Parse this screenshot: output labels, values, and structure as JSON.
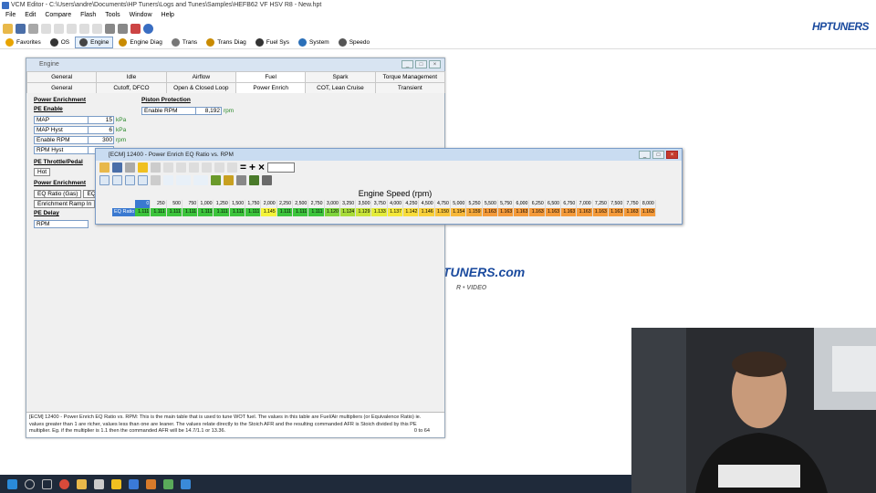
{
  "app": {
    "title": "VCM Editor - C:\\Users\\andre\\Documents\\HP Tuners\\Logs and Tunes\\Samples\\HEFB62 VF HSV R8 - New.hpt",
    "menu": [
      "File",
      "Edit",
      "Compare",
      "Flash",
      "Tools",
      "Window",
      "Help"
    ],
    "logo": "HPTUNERS"
  },
  "nav": [
    {
      "label": "Favorites",
      "icon": "star-icon",
      "color": "#e8a400"
    },
    {
      "label": "OS",
      "icon": "chip-icon",
      "color": "#333333"
    },
    {
      "label": "Engine",
      "icon": "engine-icon",
      "color": "#444444"
    },
    {
      "label": "Engine Diag",
      "icon": "engine-diag-icon",
      "color": "#c98b00"
    },
    {
      "label": "Trans",
      "icon": "gear-icon",
      "color": "#777777"
    },
    {
      "label": "Trans Diag",
      "icon": "trans-diag-icon",
      "color": "#c98b00"
    },
    {
      "label": "Fuel Sys",
      "icon": "fuel-pump-icon",
      "color": "#333333"
    },
    {
      "label": "System",
      "icon": "globe-icon",
      "color": "#2a6fb8"
    },
    {
      "label": "Speedo",
      "icon": "speedometer-icon",
      "color": "#555555"
    }
  ],
  "engine_window": {
    "title": "Engine",
    "tabs_row1": [
      "General",
      "Idle",
      "Airflow",
      "Fuel",
      "Spark",
      "Torque Management"
    ],
    "tabs_row2": [
      "General",
      "Cutoff, DFCO",
      "Open & Closed Loop",
      "Power Enrich",
      "COT, Lean Cruise",
      "Transient"
    ],
    "power_enrichment_title": "Power Enrichment",
    "pe_enable_title": "PE Enable",
    "pe_enable_fields": [
      {
        "label": "MAP",
        "value": "15",
        "unit": "kPa"
      },
      {
        "label": "MAP Hyst",
        "value": "6",
        "unit": "kPa"
      },
      {
        "label": "Enable RPM",
        "value": "300",
        "unit": "rpm"
      },
      {
        "label": "RPM Hyst",
        "value": "",
        "unit": ""
      }
    ],
    "pe_throttle_title": "PE Throttle/Pedal",
    "pe_throttle_button": "Hot",
    "power_enrichment2_title": "Power Enrichment",
    "eq_ratio_button": "EQ Ratio (Gas)",
    "eq_ratio_button2": "EQ R",
    "enrichment_ramp_button": "Enrichment Ramp In",
    "pe_delay_title": "PE Delay",
    "pe_delay_field": "RPM",
    "piston_title": "Piston Protection",
    "piston_field": {
      "label": "Enable RPM",
      "value": "8,192",
      "unit": "rpm"
    },
    "status_text": "[ECM] 12400 - Power Enrich EQ Ratio vs. RPM: This is the main table that is used to tune WOT fuel. The values in this table are Fuel/Air multipliers (or Equivalence Ratio) ie. values greater than 1 are richer, values less than one are leaner. The values relate directly to the Stoich AFR and the resulting commanded AFR is Stoich divided by this PE multiplier. Eg. if the multiplier is 1.1 then the commanded AFR will be 14.7/1.1 or 13.36.",
    "status_range": "0 to 64"
  },
  "table_window": {
    "title": "[ECM] 12400 - Power Enrich EQ Ratio vs. RPM",
    "header": "Engine Speed (rpm)",
    "row_label": "EQ Ratio",
    "rpm": [
      "0",
      "250",
      "500",
      "750",
      "1,000",
      "1,250",
      "1,500",
      "1,750",
      "2,000",
      "2,250",
      "2,500",
      "2,750",
      "3,000",
      "3,250",
      "3,500",
      "3,750",
      "4,000",
      "4,250",
      "4,500",
      "4,750",
      "5,000",
      "5,250",
      "5,500",
      "5,750",
      "6,000",
      "6,250",
      "6,500",
      "6,750",
      "7,000",
      "7,250",
      "7,500",
      "7,750",
      "8,000"
    ],
    "values": [
      "1.111",
      "1.111",
      "1.111",
      "1.111",
      "1.111",
      "1.111",
      "1.111",
      "1.111",
      "1.145",
      "1.111",
      "1.111",
      "1.111",
      "1.120",
      "1.124",
      "1.129",
      "1.133",
      "1.137",
      "1.142",
      "1.146",
      "1.150",
      "1.154",
      "1.159",
      "1.163",
      "1.163",
      "1.163",
      "1.163",
      "1.163",
      "1.163",
      "1.163",
      "1.163",
      "1.163",
      "1.163",
      "1.163"
    ],
    "colors": [
      "#3cc43c",
      "#3cc43c",
      "#3cc43c",
      "#3cc43c",
      "#3cc43c",
      "#3cc43c",
      "#3cc43c",
      "#3cc43c",
      "#f4f43a",
      "#3cc43c",
      "#3cc43c",
      "#3cc43c",
      "#7fd43c",
      "#a8dc3a",
      "#c8e43a",
      "#e4ec3a",
      "#f4e83a",
      "#f8dc3a",
      "#f8d03a",
      "#f8c43a",
      "#f8b83a",
      "#f4a83a",
      "#f49a3a",
      "#f49a3a",
      "#f49a3a",
      "#f49a3a",
      "#f49a3a",
      "#f49a3a",
      "#f49a3a",
      "#f49a3a",
      "#f49a3a",
      "#f49a3a",
      "#f49a3a"
    ]
  },
  "background_logo": {
    "text": "TUNERS.com",
    "sub": "R • VIDEO"
  }
}
